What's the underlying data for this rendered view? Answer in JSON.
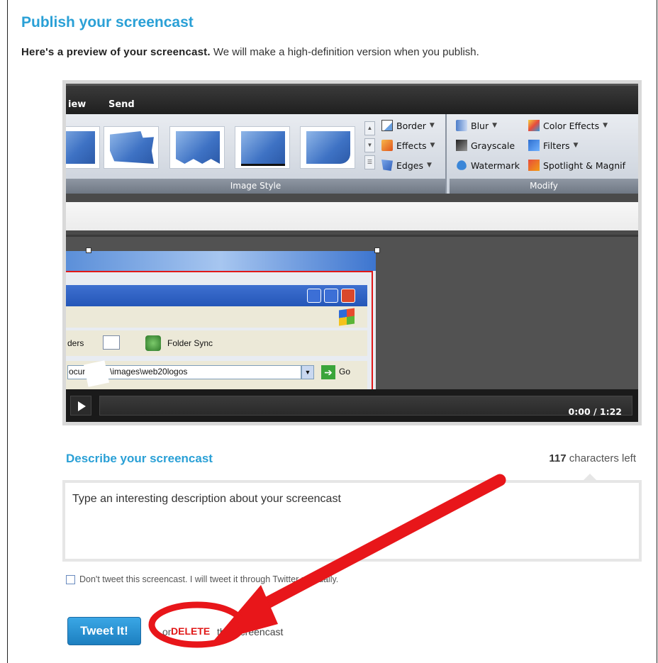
{
  "page": {
    "title": "Publish your screencast",
    "intro_bold": "Here's a preview of your screencast.",
    "intro_rest": " We will make a high-definition version when you publish."
  },
  "preview": {
    "ribbon_tabs": [
      "iew",
      "Send"
    ],
    "image_style_group": {
      "label": "Image Style",
      "items": [
        {
          "label": "Border",
          "icon": "border-icon"
        },
        {
          "label": "Effects",
          "icon": "effects-icon"
        },
        {
          "label": "Edges",
          "icon": "edges-icon"
        }
      ]
    },
    "modify_group": {
      "label": "Modify",
      "items": [
        {
          "label": "Blur",
          "icon": "blur-icon"
        },
        {
          "label": "Grayscale",
          "icon": "grayscale-icon"
        },
        {
          "label": "Watermark",
          "icon": "watermark-icon"
        },
        {
          "label": "Color Effects",
          "icon": "color-effects-icon"
        },
        {
          "label": "Filters",
          "icon": "filters-icon"
        },
        {
          "label": "Spotlight & Magnif",
          "icon": "spotlight-icon"
        }
      ]
    },
    "inner_screenshot": {
      "toolbar_left": "ders",
      "toolbar_item": "Folder Sync",
      "address_prefix": "ocur",
      "address_path": "\\images\\web20logos",
      "go_label": "Go"
    },
    "player": {
      "time": "0:00 / 1:22"
    }
  },
  "describe": {
    "label": "Describe your screencast",
    "chars_count": "117",
    "chars_suffix": " characters left",
    "placeholder": "Type an interesting description about your screencast"
  },
  "options": {
    "dont_tweet_label": "Don't tweet this screencast. I will tweet it through Twitter manually."
  },
  "actions": {
    "tweet_label": "Tweet It!",
    "or_text": "or",
    "delete_label": "DELETE",
    "delete_rest": " this screencast"
  },
  "colors": {
    "accent": "#2aa0d6",
    "delete": "#e01818",
    "annotation": "#e8161a"
  }
}
